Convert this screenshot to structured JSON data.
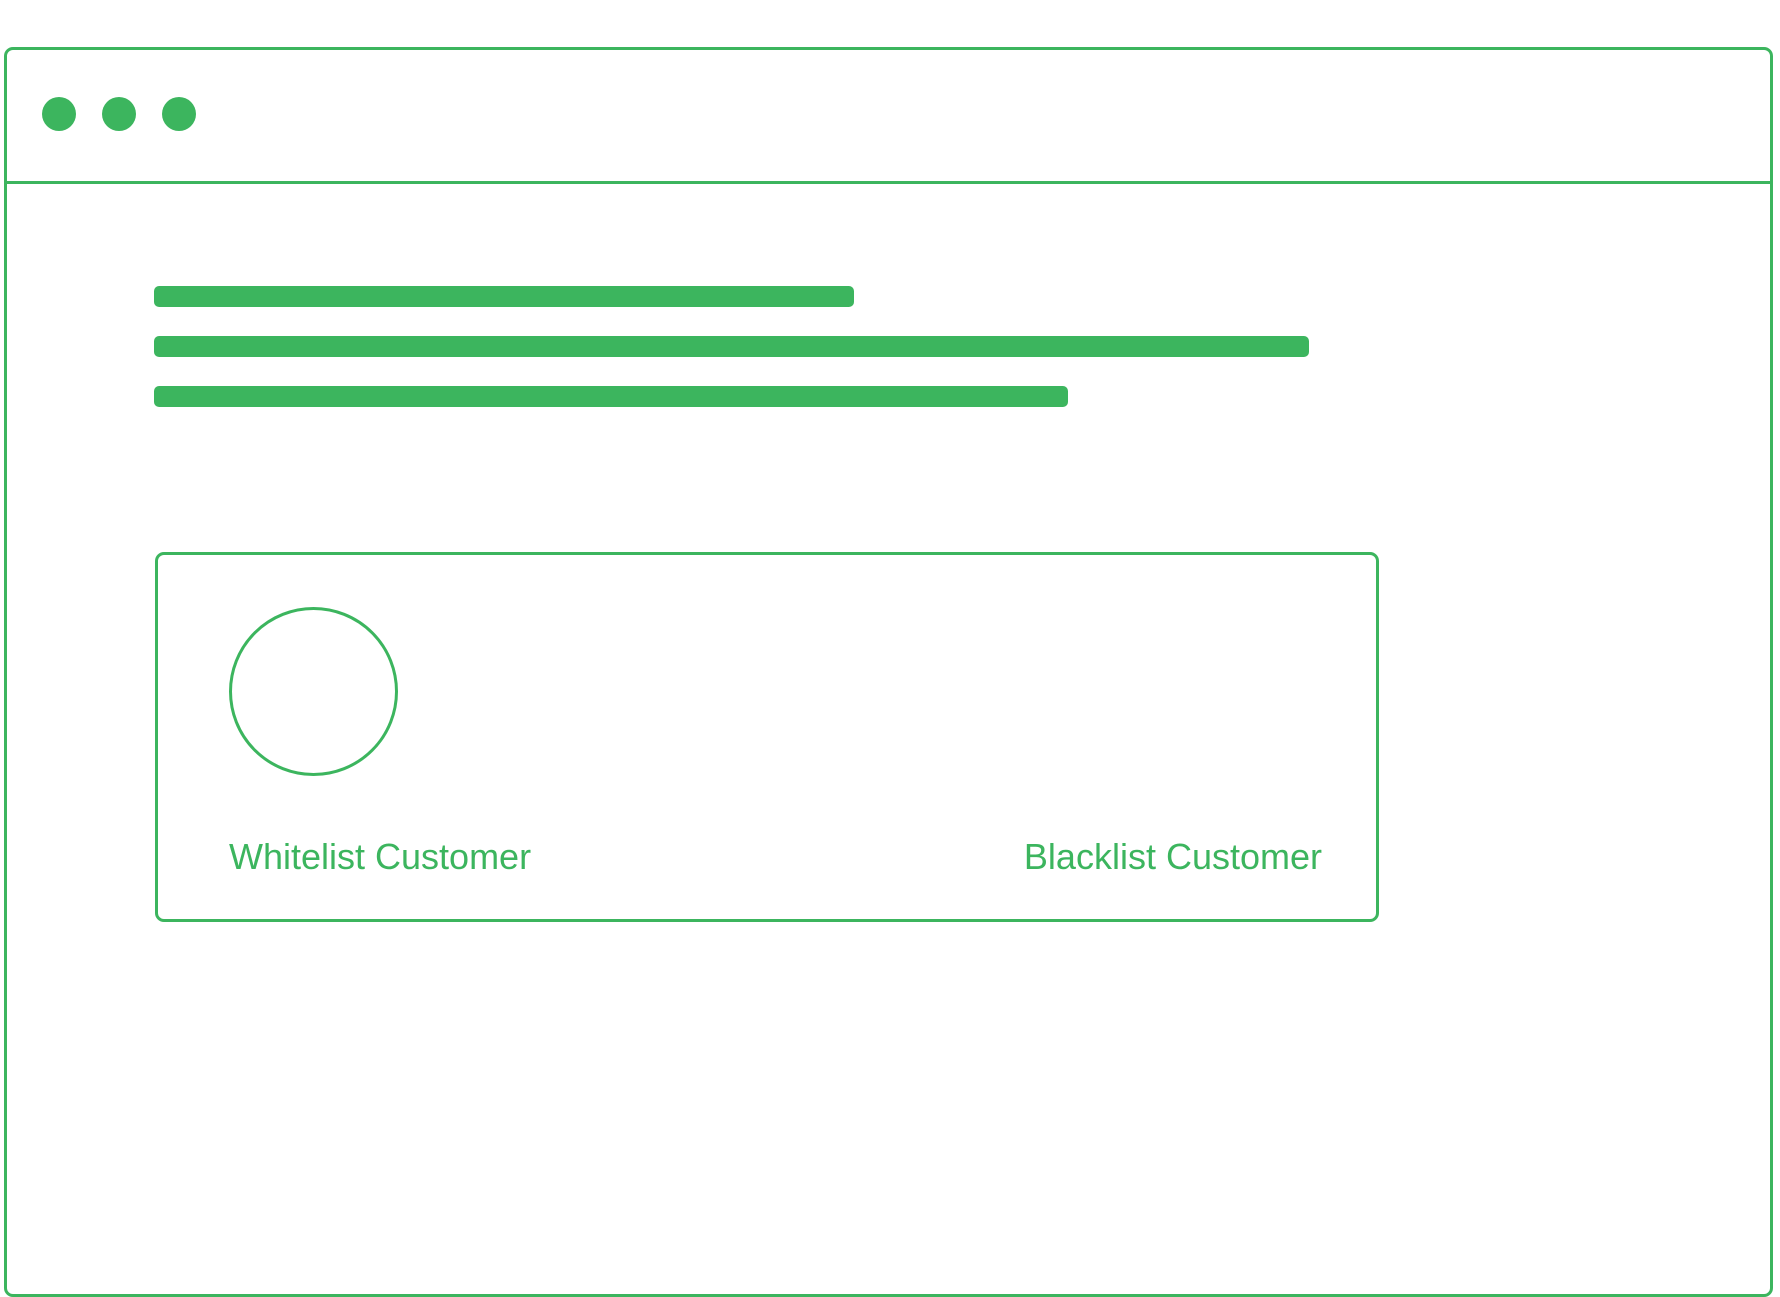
{
  "theme": {
    "accent_color": "#3CB55E",
    "background_color": "#FFFFFF"
  },
  "window": {
    "controls": [
      "window-dot-icon",
      "window-dot-icon",
      "window-dot-icon"
    ]
  },
  "content": {
    "text_placeholders": 3
  },
  "customer_card": {
    "avatar_icon": "avatar-circle-icon",
    "whitelist_label": "Whitelist Customer",
    "blacklist_label": "Blacklist Customer"
  }
}
